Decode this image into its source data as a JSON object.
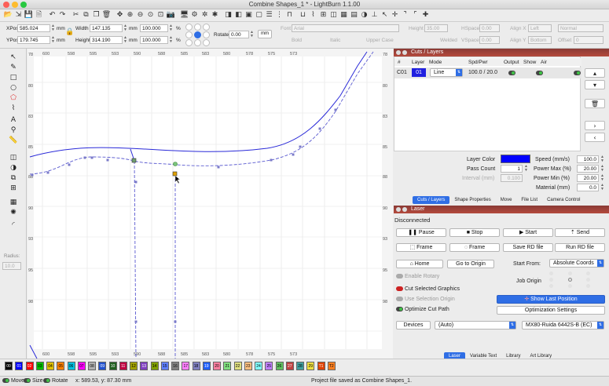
{
  "window": {
    "title": "Combine Shapes_1 * - LightBurn 1.1.00"
  },
  "toolbar": {
    "icons": [
      "open-file-icon",
      "import-icon",
      "save-icon",
      "save-as-icon",
      "undo-icon",
      "redo-icon",
      "cut-icon",
      "copy-icon",
      "duplicate-icon",
      "delete-icon",
      "move-icon",
      "zoom-in-icon",
      "zoom-out-icon",
      "zoom-fit-icon",
      "zoom-page-icon",
      "camera-icon",
      "monitor-icon",
      "settings-icon",
      "puzzle-icon",
      "magic-icon",
      "mirror-icon",
      "flip-icon",
      "group-icon",
      "ungroup-icon",
      "align-icon",
      "distribute-icon",
      "dock-icon",
      "weld-icon",
      "trace-icon",
      "break-apart-icon",
      "offset-icon",
      "grid-icon",
      "array-icon",
      "boolean-icon",
      "ruler-icon",
      "pointer-icon",
      "crosshair-icon",
      "arrow-ne-icon",
      "arrow-nw-icon",
      "origin-icon"
    ]
  },
  "numeric": {
    "xpos_label": "XPos",
    "xpos": "585.024",
    "ypos_label": "YPos",
    "ypos": "179.745",
    "unit_mm": "mm",
    "width_label": "Width",
    "width": "147.135",
    "height_label": "Height",
    "height": "314.190",
    "scale_w": "100.000",
    "scale_h": "100.000",
    "pct": "%",
    "rotate_label": "Rotate",
    "rotate": "0.00",
    "rotate_unit": "mm",
    "font_label": "Font",
    "font": "Arial",
    "fheight_label": "Height",
    "fheight": "35.00",
    "hspace_label": "HSpace",
    "hspace": "0.00",
    "vspace_label": "VSpace",
    "vspace": "0.00",
    "alignx_label": "Align X",
    "alignx": "Left",
    "aligny_label": "Align Y",
    "aligny": "Bottom",
    "style": "Normal",
    "offset_label": "Offset",
    "offset": "0",
    "bold": "Bold",
    "italic": "Italic",
    "upper": "Upper Case",
    "welded": "Welded"
  },
  "canvas": {
    "top_ticks": [
      "600",
      "598",
      "595",
      "593",
      "590",
      "588",
      "585",
      "583",
      "580",
      "578",
      "575",
      "573"
    ],
    "bottom_ticks": [
      "600",
      "598",
      "595",
      "593",
      "590",
      "588",
      "585",
      "583",
      "580",
      "578",
      "575",
      "573"
    ],
    "left_ticks": [
      "78",
      "80",
      "83",
      "85",
      "88",
      "90",
      "93",
      "95",
      "98"
    ],
    "right_ticks": [
      "78",
      "80",
      "83",
      "85",
      "88",
      "90",
      "93",
      "95",
      "98"
    ]
  },
  "left_tools": {
    "icons": [
      "select-icon",
      "edit-nodes-icon",
      "rectangle-icon",
      "ellipse-icon",
      "polygon-icon",
      "draw-lines-icon",
      "text-icon",
      "position-laser-icon",
      "measure-icon",
      "offset-icon",
      "boolean-icon",
      "weld-icon",
      "array-icon",
      "grid-array-icon",
      "circular-array-icon",
      "radius-icon"
    ],
    "radius_label": "Radius:",
    "radius_value": "10.0"
  },
  "cuts_panel": {
    "title": "Cuts / Layers",
    "columns": [
      "#",
      "Layer",
      "Mode",
      "Spd/Pwr",
      "Output",
      "Show",
      "Air"
    ],
    "rows": [
      {
        "num": "C01",
        "layer": "01",
        "layer_color": "#2020e0",
        "mode": "Line",
        "spdpwr": "100.0 / 20.0"
      }
    ],
    "layer_color_label": "Layer Color",
    "layer_color": "#0000ff",
    "speed_label": "Speed (mm/s)",
    "speed": "100.0",
    "pass_label": "Pass Count",
    "pass": "1",
    "pmax_label": "Power Max (%)",
    "pmax": "20.00",
    "interval_label": "Interval (mm)",
    "interval": "0.100",
    "pmin_label": "Power Min (%)",
    "pmin": "20.00",
    "material_label": "Material (mm)",
    "material": "0.0",
    "tabs": [
      "Cuts / Layers",
      "Shape Properties",
      "Move",
      "File List",
      "Camera Control"
    ]
  },
  "laser_panel": {
    "title": "Laser",
    "status": "Disconnected",
    "pause": "Pause",
    "stop": "Stop",
    "start": "Start",
    "send": "Send",
    "frame1": "Frame",
    "frame2": "Frame",
    "save_rd": "Save RD file",
    "run_rd": "Run RD file",
    "home": "Home",
    "go_origin": "Go to Origin",
    "start_from_label": "Start From:",
    "start_from": "Absolute Coords",
    "enable_rotary": "Enable Rotary",
    "job_origin": "Job Origin",
    "cut_selected": "Cut Selected Graphics",
    "use_selection_origin": "Use Selection Origin",
    "show_last_position": "Show Last Position",
    "optimize_cut_path": "Optimize Cut Path",
    "optimization_settings": "Optimization Settings",
    "devices": "Devices",
    "device_sel": "(Auto)",
    "controller": "MX80-Ruida 6442S-B (EC)",
    "tabs": [
      "Laser",
      "Variable Text",
      "Library",
      "Art Library"
    ]
  },
  "palette": {
    "swatches": [
      {
        "label": "00",
        "color": "#000000",
        "fg": "#ffffff"
      },
      {
        "label": "01",
        "color": "#0000ff",
        "fg": "#ffffff"
      },
      {
        "label": "02",
        "color": "#ff0000",
        "fg": "#ffffff"
      },
      {
        "label": "03",
        "color": "#00c000",
        "fg": "#000000"
      },
      {
        "label": "04",
        "color": "#e0c000",
        "fg": "#000000"
      },
      {
        "label": "05",
        "color": "#ff8000",
        "fg": "#000000"
      },
      {
        "label": "06",
        "color": "#00c0e0",
        "fg": "#000000"
      },
      {
        "label": "07",
        "color": "#ff00ff",
        "fg": "#000000"
      },
      {
        "label": "08",
        "color": "#b0b0b0",
        "fg": "#000000"
      },
      {
        "label": "09",
        "color": "#2050d0",
        "fg": "#ffffff"
      },
      {
        "label": "10",
        "color": "#206020",
        "fg": "#ffffff"
      },
      {
        "label": "11",
        "color": "#c00040",
        "fg": "#ffffff"
      },
      {
        "label": "12",
        "color": "#a0a000",
        "fg": "#000000"
      },
      {
        "label": "13",
        "color": "#8040c0",
        "fg": "#ffffff"
      },
      {
        "label": "14",
        "color": "#80a000",
        "fg": "#000000"
      },
      {
        "label": "15",
        "color": "#6080ff",
        "fg": "#000000"
      },
      {
        "label": "16",
        "color": "#808080",
        "fg": "#000000"
      },
      {
        "label": "17",
        "color": "#ff80ff",
        "fg": "#000000"
      },
      {
        "label": "18",
        "color": "#8080c0",
        "fg": "#000000"
      },
      {
        "label": "19",
        "color": "#2060ff",
        "fg": "#ffffff"
      },
      {
        "label": "20",
        "color": "#ff80a0",
        "fg": "#000000"
      },
      {
        "label": "21",
        "color": "#80e080",
        "fg": "#000000"
      },
      {
        "label": "22",
        "color": "#e0e080",
        "fg": "#000000"
      },
      {
        "label": "23",
        "color": "#ffc080",
        "fg": "#000000"
      },
      {
        "label": "24",
        "color": "#80ffff",
        "fg": "#000000"
      },
      {
        "label": "25",
        "color": "#c080ff",
        "fg": "#000000"
      },
      {
        "label": "26",
        "color": "#60c060",
        "fg": "#000000"
      },
      {
        "label": "27",
        "color": "#c04040",
        "fg": "#ffffff"
      },
      {
        "label": "28",
        "color": "#40a0a0",
        "fg": "#000000"
      },
      {
        "label": "29",
        "color": "#f0e040",
        "fg": "#000000"
      },
      {
        "label": "T1",
        "color": "#e04000",
        "fg": "#ffffff"
      },
      {
        "label": "T2",
        "color": "#ff8020",
        "fg": "#000000"
      }
    ]
  },
  "statusbar": {
    "move": "Move",
    "size": "Size",
    "rotate": "Rotate",
    "coords": "x: 589.53, y: 87.30 mm",
    "message": "Project file saved as Combine Shapes_1."
  }
}
